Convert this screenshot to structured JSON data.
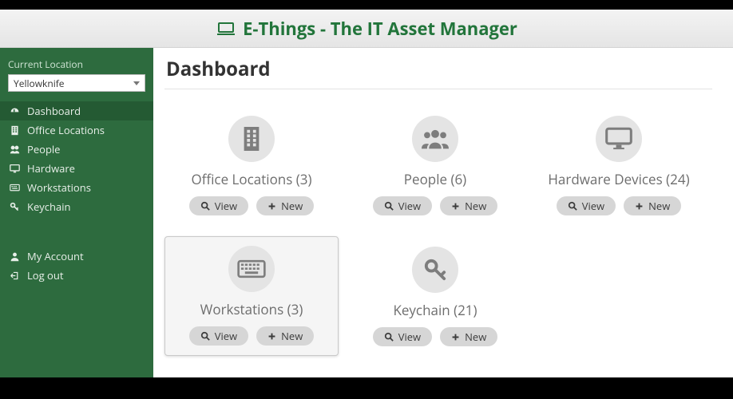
{
  "app": {
    "name": "E-Things - The IT Asset Manager"
  },
  "sidebar": {
    "location_label": "Current Location",
    "location_value": "Yellowknife",
    "primary": [
      {
        "label": "Dashboard",
        "icon": "dashboard-icon",
        "active": true
      },
      {
        "label": "Office Locations",
        "icon": "building-icon",
        "active": false
      },
      {
        "label": "People",
        "icon": "people-icon",
        "active": false
      },
      {
        "label": "Hardware",
        "icon": "monitor-icon",
        "active": false
      },
      {
        "label": "Workstations",
        "icon": "keyboard-icon",
        "active": false
      },
      {
        "label": "Keychain",
        "icon": "key-icon",
        "active": false
      }
    ],
    "secondary": [
      {
        "label": "My Account",
        "icon": "user-icon"
      },
      {
        "label": "Log out",
        "icon": "logout-icon"
      }
    ]
  },
  "page": {
    "title": "Dashboard",
    "buttons": {
      "view": "View",
      "new": "New"
    },
    "cards": [
      {
        "id": "office-locations",
        "label": "Office Locations",
        "count": 3,
        "icon": "building-icon",
        "hover": false
      },
      {
        "id": "people",
        "label": "People",
        "count": 6,
        "icon": "people-icon",
        "hover": false
      },
      {
        "id": "hardware-devices",
        "label": "Hardware Devices",
        "count": 24,
        "icon": "monitor-icon",
        "hover": false
      },
      {
        "id": "workstations",
        "label": "Workstations",
        "count": 3,
        "icon": "keyboard-icon",
        "hover": true
      },
      {
        "id": "keychain",
        "label": "Keychain",
        "count": 21,
        "icon": "key-icon",
        "hover": false
      }
    ]
  }
}
